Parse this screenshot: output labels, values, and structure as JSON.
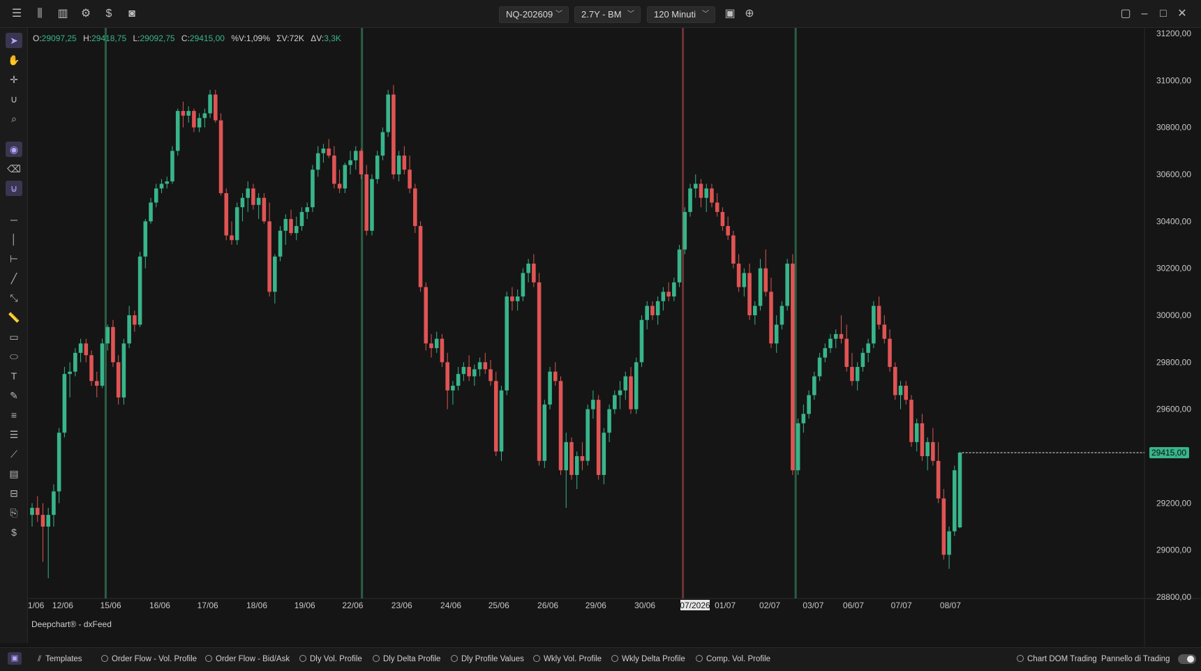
{
  "toolbar": {
    "symbol": "NQ-202609",
    "period": "2.7Y - BM",
    "timeframe": "120 Minuti"
  },
  "ohlc": {
    "o_label": "O:",
    "o": "29097,25",
    "h_label": "H:",
    "h": "29418,75",
    "l_label": "L:",
    "l": "29092,75",
    "c_label": "C:",
    "c": "29415,00",
    "pv_label": "%V:",
    "pv": "1,09%",
    "sv_label": "ΣV:",
    "sv": "72K",
    "dv_label": "ΔV:",
    "dv": "3,3K"
  },
  "watermark": "Deepchart® - dxFeed",
  "bottom": {
    "templates": "Templates",
    "items": [
      "Order Flow - Vol. Profile",
      "Order Flow - Bid/Ask",
      "Dly Vol. Profile",
      "Dly Delta Profile",
      "Dly Profile Values",
      "Wkly Vol. Profile",
      "Wkly Delta Profile",
      "Comp. Vol. Profile"
    ],
    "chart_dom": "Chart DOM Trading",
    "trading_panel": "Pannello di Trading"
  },
  "colors": {
    "up": "#38b58a",
    "down": "#e05454",
    "bg": "#151515",
    "grid": "#232323",
    "session_line_green": "#2e6b4c",
    "session_line_red": "#7a3a3a"
  },
  "chart_data": {
    "type": "candlestick",
    "symbol": "NQ-202609",
    "ylim": [
      28800,
      31200
    ],
    "y_ticks": [
      "31200,00",
      "31000,00",
      "30800,00",
      "30600,00",
      "30400,00",
      "30200,00",
      "30000,00",
      "29800,00",
      "29600,00",
      "29415,00",
      "29200,00",
      "29000,00",
      "28800,00"
    ],
    "last_price": "29415,00",
    "x_labels": [
      "1/06",
      "12/06",
      "15/06",
      "16/06",
      "17/06",
      "18/06",
      "19/06",
      "22/06",
      "23/06",
      "24/06",
      "25/06",
      "26/06",
      "29/06",
      "30/06",
      "07/2026",
      "01/07",
      "02/07",
      "03/07",
      "06/07",
      "07/07",
      "08/07"
    ],
    "highlighted_x_label": "07/2026",
    "candles": [
      [
        29150,
        29200,
        29100,
        29180
      ],
      [
        29180,
        29230,
        29120,
        29150
      ],
      [
        29150,
        29200,
        28950,
        29100
      ],
      [
        29100,
        29180,
        28880,
        29150
      ],
      [
        29150,
        29280,
        29100,
        29250
      ],
      [
        29250,
        29520,
        29200,
        29500
      ],
      [
        29500,
        29780,
        29480,
        29750
      ],
      [
        29750,
        29800,
        29650,
        29760
      ],
      [
        29760,
        29860,
        29740,
        29840
      ],
      [
        29840,
        29900,
        29800,
        29880
      ],
      [
        29880,
        29900,
        29800,
        29830
      ],
      [
        29830,
        29850,
        29700,
        29720
      ],
      [
        29720,
        29760,
        29650,
        29700
      ],
      [
        29700,
        29900,
        29690,
        29880
      ],
      [
        29880,
        29960,
        29850,
        29950
      ],
      [
        29950,
        29980,
        29780,
        29800
      ],
      [
        29800,
        29830,
        29620,
        29650
      ],
      [
        29650,
        29900,
        29620,
        29880
      ],
      [
        29880,
        30040,
        29860,
        30000
      ],
      [
        30000,
        30020,
        29930,
        29960
      ],
      [
        29960,
        30270,
        29950,
        30250
      ],
      [
        30250,
        30410,
        30200,
        30400
      ],
      [
        30400,
        30500,
        30390,
        30480
      ],
      [
        30480,
        30560,
        30460,
        30540
      ],
      [
        30540,
        30580,
        30520,
        30560
      ],
      [
        30560,
        30590,
        30540,
        30570
      ],
      [
        30570,
        30720,
        30560,
        30700
      ],
      [
        30700,
        30880,
        30680,
        30870
      ],
      [
        30870,
        30910,
        30800,
        30850
      ],
      [
        30850,
        30890,
        30820,
        30870
      ],
      [
        30870,
        30880,
        30780,
        30800
      ],
      [
        30800,
        30860,
        30780,
        30840
      ],
      [
        30840,
        30880,
        30800,
        30860
      ],
      [
        30860,
        30960,
        30840,
        30940
      ],
      [
        30940,
        30960,
        30820,
        30830
      ],
      [
        30830,
        30860,
        30510,
        30520
      ],
      [
        30520,
        30540,
        30320,
        30340
      ],
      [
        30340,
        30400,
        30300,
        30320
      ],
      [
        30320,
        30480,
        30300,
        30460
      ],
      [
        30460,
        30520,
        30400,
        30500
      ],
      [
        30500,
        30570,
        30440,
        30540
      ],
      [
        30540,
        30560,
        30450,
        30470
      ],
      [
        30470,
        30520,
        30410,
        30500
      ],
      [
        30500,
        30520,
        30390,
        30400
      ],
      [
        30400,
        30480,
        30080,
        30100
      ],
      [
        30100,
        30260,
        30050,
        30250
      ],
      [
        30250,
        30380,
        30230,
        30360
      ],
      [
        30360,
        30430,
        30300,
        30410
      ],
      [
        30410,
        30450,
        30340,
        30350
      ],
      [
        30350,
        30420,
        30320,
        30380
      ],
      [
        30380,
        30460,
        30360,
        30440
      ],
      [
        30440,
        30480,
        30410,
        30460
      ],
      [
        30460,
        30640,
        30440,
        30620
      ],
      [
        30620,
        30720,
        30590,
        30690
      ],
      [
        30690,
        30730,
        30650,
        30710
      ],
      [
        30710,
        30750,
        30670,
        30680
      ],
      [
        30680,
        30720,
        30540,
        30560
      ],
      [
        30560,
        30620,
        30520,
        30540
      ],
      [
        30540,
        30650,
        30520,
        30640
      ],
      [
        30640,
        30700,
        30600,
        30660
      ],
      [
        30660,
        30720,
        30620,
        30700
      ],
      [
        30700,
        30710,
        30580,
        30600
      ],
      [
        30600,
        30640,
        30340,
        30360
      ],
      [
        30360,
        30600,
        30340,
        30580
      ],
      [
        30580,
        30700,
        30560,
        30680
      ],
      [
        30680,
        30800,
        30660,
        30780
      ],
      [
        30780,
        30960,
        30760,
        30940
      ],
      [
        30940,
        30980,
        30580,
        30600
      ],
      [
        30600,
        30700,
        30570,
        30680
      ],
      [
        30680,
        30720,
        30600,
        30620
      ],
      [
        30620,
        30680,
        30520,
        30540
      ],
      [
        30540,
        30560,
        30350,
        30380
      ],
      [
        30380,
        30400,
        30100,
        30120
      ],
      [
        30120,
        30140,
        29850,
        29880
      ],
      [
        29880,
        29920,
        29820,
        29860
      ],
      [
        29860,
        29930,
        29840,
        29900
      ],
      [
        29900,
        29920,
        29780,
        29800
      ],
      [
        29800,
        29840,
        29600,
        29680
      ],
      [
        29680,
        29720,
        29620,
        29700
      ],
      [
        29700,
        29780,
        29680,
        29750
      ],
      [
        29750,
        29800,
        29720,
        29780
      ],
      [
        29780,
        29830,
        29720,
        29740
      ],
      [
        29740,
        29790,
        29700,
        29770
      ],
      [
        29770,
        29820,
        29740,
        29800
      ],
      [
        29800,
        29840,
        29750,
        29770
      ],
      [
        29770,
        29810,
        29700,
        29720
      ],
      [
        29720,
        29760,
        29400,
        29420
      ],
      [
        29420,
        29700,
        29380,
        29680
      ],
      [
        29680,
        30100,
        29660,
        30080
      ],
      [
        30080,
        30120,
        30020,
        30060
      ],
      [
        30060,
        30110,
        30020,
        30080
      ],
      [
        30080,
        30200,
        30060,
        30180
      ],
      [
        30180,
        30240,
        30140,
        30220
      ],
      [
        30220,
        30260,
        30120,
        30140
      ],
      [
        30140,
        30180,
        29360,
        29380
      ],
      [
        29380,
        29640,
        29350,
        29620
      ],
      [
        29620,
        29780,
        29600,
        29760
      ],
      [
        29760,
        29800,
        29700,
        29720
      ],
      [
        29720,
        29740,
        29320,
        29340
      ],
      [
        29340,
        29500,
        29180,
        29460
      ],
      [
        29460,
        29480,
        29300,
        29320
      ],
      [
        29320,
        29420,
        29260,
        29400
      ],
      [
        29400,
        29460,
        29340,
        29380
      ],
      [
        29380,
        29620,
        29360,
        29600
      ],
      [
        29600,
        29680,
        29560,
        29640
      ],
      [
        29640,
        29660,
        29300,
        29320
      ],
      [
        29320,
        29520,
        29280,
        29500
      ],
      [
        29500,
        29620,
        29460,
        29600
      ],
      [
        29600,
        29680,
        29580,
        29660
      ],
      [
        29660,
        29720,
        29600,
        29680
      ],
      [
        29680,
        29760,
        29640,
        29740
      ],
      [
        29740,
        29780,
        29580,
        29600
      ],
      [
        29600,
        29820,
        29580,
        29800
      ],
      [
        29800,
        30000,
        29780,
        29980
      ],
      [
        29980,
        30060,
        29940,
        30040
      ],
      [
        30040,
        30060,
        29980,
        30000
      ],
      [
        30000,
        30080,
        29960,
        30060
      ],
      [
        30060,
        30120,
        30020,
        30100
      ],
      [
        30100,
        30140,
        30060,
        30080
      ],
      [
        30080,
        30160,
        30060,
        30140
      ],
      [
        30140,
        30300,
        30120,
        30280
      ],
      [
        30280,
        30460,
        30260,
        30440
      ],
      [
        30440,
        30560,
        30420,
        30540
      ],
      [
        30540,
        30600,
        30500,
        30560
      ],
      [
        30560,
        30580,
        30460,
        30500
      ],
      [
        30500,
        30560,
        30440,
        30540
      ],
      [
        30540,
        30560,
        30460,
        30480
      ],
      [
        30480,
        30520,
        30420,
        30440
      ],
      [
        30440,
        30460,
        30360,
        30380
      ],
      [
        30380,
        30420,
        30320,
        30340
      ],
      [
        30340,
        30360,
        30200,
        30220
      ],
      [
        30220,
        30260,
        30100,
        30120
      ],
      [
        30120,
        30200,
        30080,
        30180
      ],
      [
        30180,
        30220,
        29980,
        30000
      ],
      [
        30000,
        30060,
        29960,
        30040
      ],
      [
        30040,
        30240,
        30020,
        30200
      ],
      [
        30200,
        30280,
        30080,
        30100
      ],
      [
        30100,
        30160,
        29860,
        29880
      ],
      [
        29880,
        30000,
        29840,
        29960
      ],
      [
        29960,
        30060,
        29940,
        30040
      ],
      [
        30040,
        30240,
        30020,
        30220
      ],
      [
        30220,
        30260,
        29320,
        29340
      ],
      [
        29340,
        29560,
        29320,
        29540
      ],
      [
        29540,
        29620,
        29500,
        29580
      ],
      [
        29580,
        29680,
        29560,
        29660
      ],
      [
        29660,
        29760,
        29640,
        29740
      ],
      [
        29740,
        29840,
        29720,
        29820
      ],
      [
        29820,
        29880,
        29800,
        29860
      ],
      [
        29860,
        29920,
        29840,
        29900
      ],
      [
        29900,
        29940,
        29860,
        29920
      ],
      [
        29920,
        30000,
        29880,
        29900
      ],
      [
        29900,
        29960,
        29760,
        29780
      ],
      [
        29780,
        29840,
        29700,
        29720
      ],
      [
        29720,
        29800,
        29680,
        29780
      ],
      [
        29780,
        29860,
        29760,
        29840
      ],
      [
        29840,
        29900,
        29800,
        29880
      ],
      [
        29880,
        30060,
        29860,
        30040
      ],
      [
        30040,
        30080,
        29940,
        29960
      ],
      [
        29960,
        30000,
        29880,
        29900
      ],
      [
        29900,
        29940,
        29760,
        29780
      ],
      [
        29780,
        29800,
        29640,
        29660
      ],
      [
        29660,
        29720,
        29600,
        29700
      ],
      [
        29700,
        29720,
        29620,
        29640
      ],
      [
        29640,
        29660,
        29440,
        29460
      ],
      [
        29460,
        29560,
        29420,
        29540
      ],
      [
        29540,
        29580,
        29380,
        29400
      ],
      [
        29400,
        29480,
        29340,
        29460
      ],
      [
        29460,
        29520,
        29360,
        29380
      ],
      [
        29380,
        29460,
        29200,
        29220
      ],
      [
        29220,
        29260,
        28960,
        28980
      ],
      [
        28980,
        29100,
        28920,
        29080
      ],
      [
        29080,
        29360,
        29060,
        29340
      ],
      [
        29097,
        29419,
        29093,
        29415
      ]
    ]
  }
}
